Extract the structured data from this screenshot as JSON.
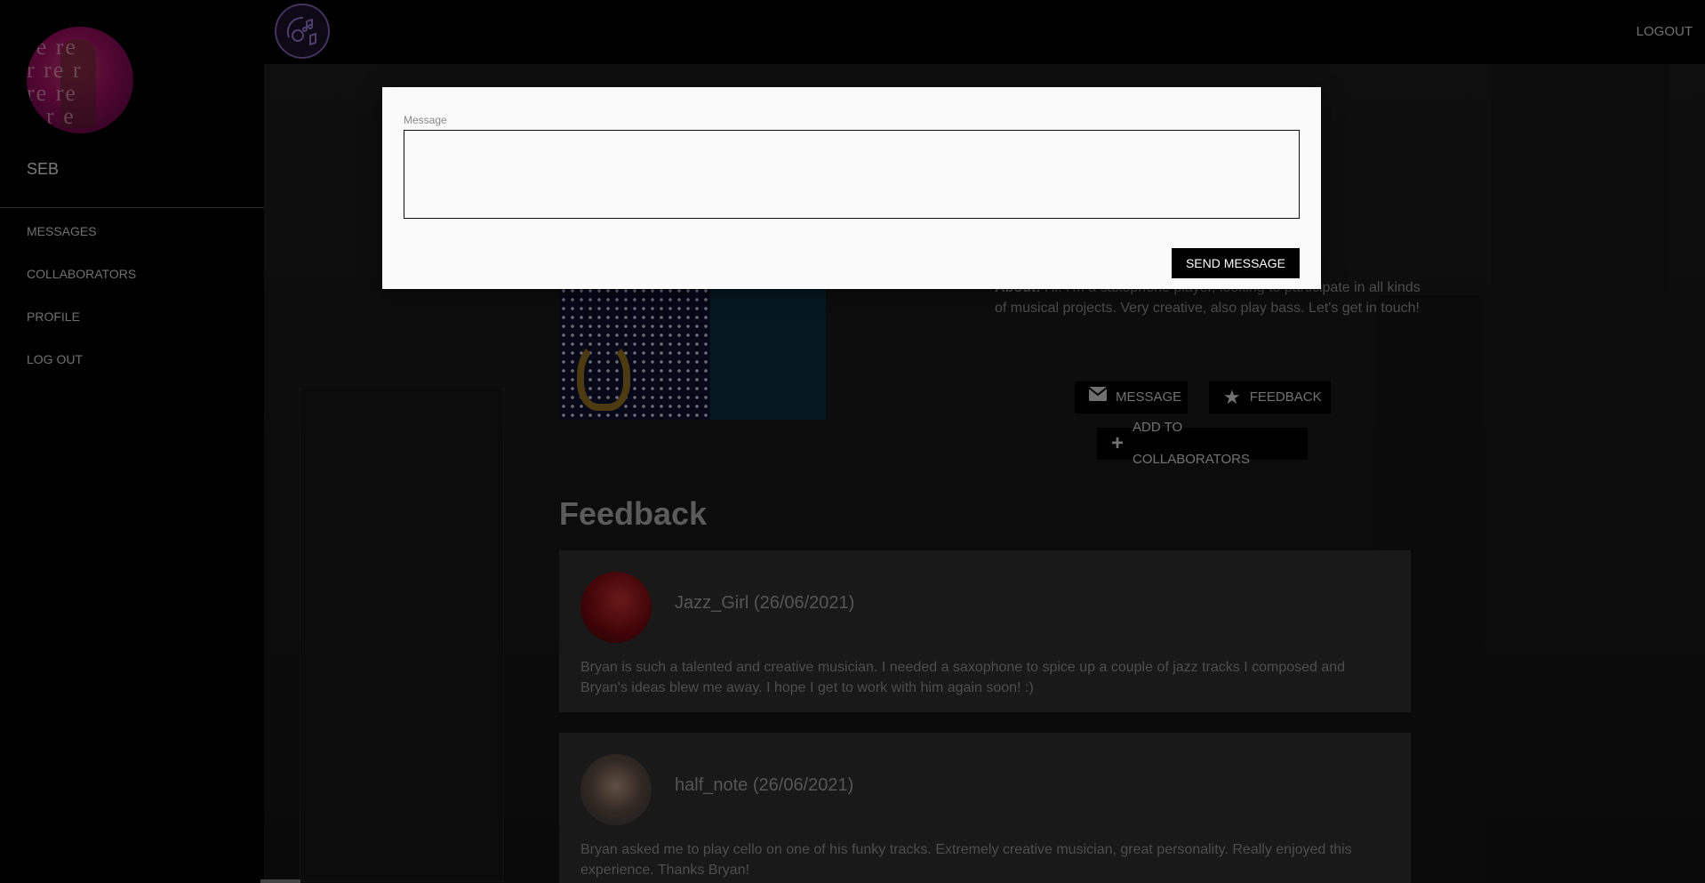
{
  "sidebar": {
    "user_name": "SEB",
    "items": [
      {
        "label": "MESSAGES"
      },
      {
        "label": "COLLABORATORS"
      },
      {
        "label": "PROFILE"
      },
      {
        "label": "LOG OUT"
      }
    ]
  },
  "topbar": {
    "logout_label": "LOGOUT",
    "logo_icon": "music-note-logo-icon"
  },
  "profile": {
    "about_label": "About:",
    "about_text": " Hi! I'm a saxophone player, looking to participate in all kinds of musical projects. Very creative, also play bass. Let's get in touch!",
    "buttons": {
      "message": "MESSAGE",
      "feedback": "FEEDBACK",
      "add_collaborators": "ADD TO COLLABORATORS"
    }
  },
  "feedback": {
    "heading": "Feedback",
    "entries": [
      {
        "author": "Jazz_Girl (26/06/2021)",
        "text": "Bryan is such a talented and creative musician. I needed a saxophone to spice up a couple of jazz tracks I composed and Bryan's ideas blew me away. I hope I get to work with him again soon! :)"
      },
      {
        "author": "half_note (26/06/2021)",
        "text": "Bryan asked me to play cello on one of his funky tracks. Extremely creative musician, great personality. Really enjoyed this experience. Thanks Bryan!"
      }
    ]
  },
  "modal": {
    "label": "Message",
    "textarea_value": "",
    "send_label": "SEND MESSAGE"
  },
  "colors": {
    "modal_bg": "#fafafa",
    "card_bg": "#2e2e2e",
    "logo_ring": "#7b5fa8"
  }
}
